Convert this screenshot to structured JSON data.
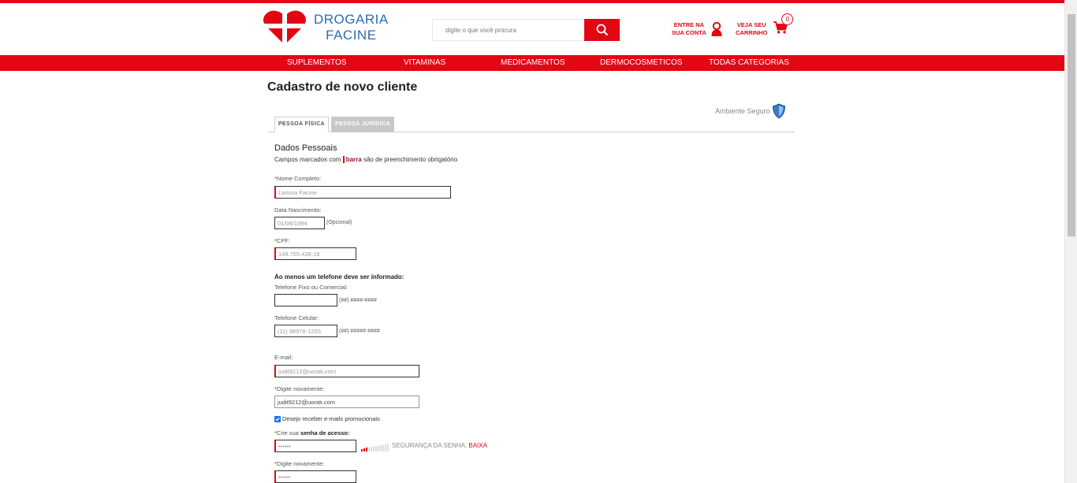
{
  "brand": {
    "line1": "DROGARIA",
    "line2": "FACINE",
    "accent": "#e30613",
    "logo_text_color": "#2b6cb0"
  },
  "search": {
    "placeholder": "digite o que você procura"
  },
  "header": {
    "account_line1": "ENTRE NA",
    "account_line2": "SUA CONTA",
    "cart_line1": "VEJA SEU",
    "cart_line2": "CARRINHO",
    "cart_count": "0"
  },
  "nav": [
    "SUPLEMENTOS",
    "VITAMINAS",
    "MEDICAMENTOS",
    "DERMOCOSMETICOS",
    "TODAS CATEGORIAS"
  ],
  "page": {
    "title": "Cadastro de novo cliente",
    "secure_label": "Ambiente Seguro"
  },
  "tabs": {
    "fisica": "PESSOA FÍSICA",
    "juridica": "PESSOA JURÍDICA"
  },
  "form": {
    "section_title": "Dados Pessoais",
    "required_prefix": "Campos marcados com",
    "required_bar": "barra",
    "required_suffix": "são de preenchimento obrigatório",
    "name_label": "*Nome Completo:",
    "name_value": "Larissa Facine",
    "birth_label": "Data Nascimento:",
    "birth_value": "01/08/1994",
    "birth_hint": "(Opcional)",
    "cpf_label": "*CPF:",
    "cpf_value": "149.755.438-18",
    "phone_note": "Ao menos um telefone deve ser informado:",
    "landline_label": "Telefone Fixo ou Comercial:",
    "landline_value": "",
    "landline_hint": "(##) ####-####",
    "mobile_label": "Telefone Celular:",
    "mobile_value": "(11) 98976-1255",
    "mobile_hint": "(##) #####-####",
    "email_label": "E-mail:",
    "email_value": "judit9212@uorak.com",
    "email_confirm_label": "*Digite novamente:",
    "email_confirm_value": "judit9212@uorak.com",
    "promo_label": "Desejo receber e-mails promocionais",
    "promo_checked": true,
    "password_label_prefix": "*Crie sua",
    "password_label_bold": "senha de acesso:",
    "password_value": "••••••",
    "strength_label": "SEGURANÇA DA SENHA:",
    "strength_level": "BAIXA",
    "password_confirm_label": "*Digite novamente:",
    "password_confirm_value": "••••••"
  }
}
